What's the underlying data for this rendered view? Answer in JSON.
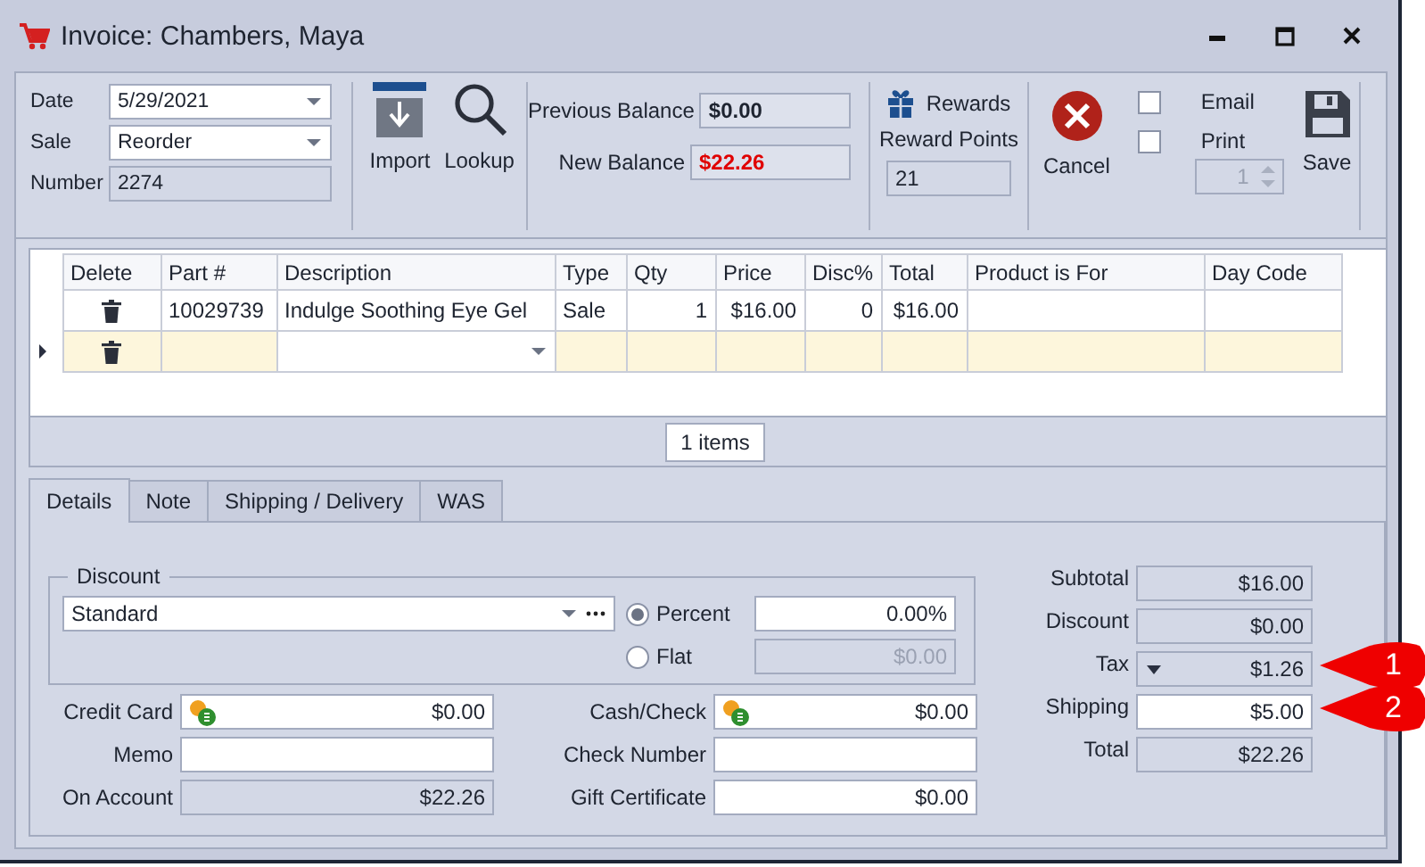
{
  "window": {
    "title": "Invoice: Chambers, Maya"
  },
  "header_fields": [
    {
      "label": "Date",
      "value": "5/29/2021",
      "kind": "dropdown"
    },
    {
      "label": "Sale",
      "value": "Reorder",
      "kind": "dropdown"
    },
    {
      "label": "Number",
      "value": "2274",
      "kind": "readonly"
    }
  ],
  "tools": [
    {
      "label": "Import",
      "kind": "import"
    },
    {
      "label": "Lookup",
      "kind": "lookup"
    }
  ],
  "balances": [
    {
      "label": "Previous Balance",
      "value": "$0.00",
      "alert": false
    },
    {
      "label": "New Balance",
      "value": "$22.26",
      "alert": true
    }
  ],
  "rewards": {
    "label": "Rewards",
    "points_label": "Reward Points",
    "points": "21"
  },
  "cancel": {
    "label": "Cancel"
  },
  "output_options": [
    {
      "label": "Email",
      "checked": false
    },
    {
      "label": "Print",
      "checked": false
    }
  ],
  "copies": {
    "value": "1",
    "disabled": true
  },
  "save": {
    "label": "Save"
  },
  "grid": {
    "columns": [
      "Delete",
      "Part #",
      "Description",
      "Type",
      "Qty",
      "Price",
      "Disc%",
      "Total",
      "Product is For",
      "Day Code"
    ],
    "rows": [
      {
        "part": "10029739",
        "description": "Indulge Soothing Eye Gel",
        "type": "Sale",
        "qty": "1",
        "price": "$16.00",
        "disc": "0",
        "total": "$16.00",
        "current": false
      },
      {
        "current": true
      }
    ],
    "count": "1 items"
  },
  "tabs": [
    {
      "label": "Details",
      "selected": true
    },
    {
      "label": "Note",
      "selected": false
    },
    {
      "label": "Shipping / Delivery",
      "selected": false
    },
    {
      "label": "WAS",
      "selected": false
    }
  ],
  "discount": {
    "title": "Discount",
    "scheme": "Standard",
    "modes": [
      {
        "label": "Percent",
        "selected": true,
        "value": "0.00%"
      },
      {
        "label": "Flat",
        "selected": false,
        "value": "$0.00"
      }
    ]
  },
  "payments": [
    {
      "label": "Credit Card",
      "value": "$0.00",
      "kind": "money"
    },
    {
      "label": "Memo",
      "kind": "text"
    },
    {
      "label": "On Account",
      "value": "$22.26",
      "kind": "readonly"
    },
    {
      "label": "Cash/Check",
      "value": "$0.00",
      "kind": "money"
    },
    {
      "label": "Check Number",
      "kind": "text"
    },
    {
      "label": "Gift Certificate",
      "value": "$0.00",
      "kind": "text"
    }
  ],
  "totals": [
    {
      "label": "Subtotal",
      "value": "$16.00",
      "kind": "readonly"
    },
    {
      "label": "Discount",
      "value": "$0.00",
      "kind": "readonly"
    },
    {
      "label": "Tax",
      "value": "$1.26",
      "kind": "dropdown",
      "callout": "1"
    },
    {
      "label": "Shipping",
      "value": "$5.00",
      "kind": "editable",
      "callout": "2"
    },
    {
      "label": "Total",
      "value": "$22.26",
      "kind": "readonly"
    }
  ]
}
